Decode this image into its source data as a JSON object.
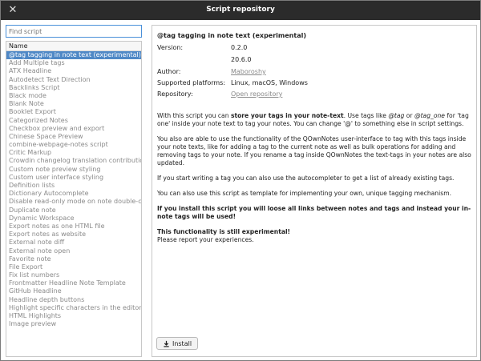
{
  "window": {
    "title": "Script repository"
  },
  "search": {
    "placeholder": "Find script",
    "value": ""
  },
  "list": {
    "header": "Name",
    "items": [
      "@tag tagging in note text (experimental)",
      "Add Multiple tags",
      "ATX Headline",
      "Autodetect Text Direction",
      "Backlinks Script",
      "Black mode",
      "Blank Note",
      "Booklet Export",
      "Categorized Notes",
      "Checkbox preview and export",
      "Chinese Space Preview",
      "combine-webpage-notes script",
      "Critic Markup",
      "Crowdin changelog translation contribution",
      "Custom note preview styling",
      "Custom user interface styling",
      "Definition lists",
      "Dictionary Autocomplete",
      "Disable read-only mode on note double-click",
      "Duplicate note",
      "Dynamic Workspace",
      "Export notes as one HTML file",
      "Export notes as website",
      "External note diff",
      "External note open",
      "Favorite note",
      "File Export",
      "Fix list numbers",
      "Frontmatter Headline Note Template",
      "GitHub Headline",
      "Headline depth buttons",
      "Highlight specific characters in the editor",
      "HTML Highlights",
      "Image preview"
    ]
  },
  "details": {
    "title": "@tag tagging in note text (experimental)",
    "version_label": "Version:",
    "version": "0.2.0",
    "min_version": "20.6.0",
    "author_label": "Author:",
    "author": "Maboroshy",
    "platforms_label": "Supported platforms:",
    "platforms": "Linux, macOS, Windows",
    "repository_label": "Repository:",
    "repository": "Open repository",
    "p1_a": "With this script you can ",
    "p1_b": "store your tags in your note-text",
    "p1_c": ". Use tags like ",
    "p1_d": "@tag",
    "p1_e": " or ",
    "p1_f": "@tag_one",
    "p1_g": " for 'tag one' inside your note text to tag your notes. You can change '@' to something else in script settings.",
    "p2": "You also are able to use the functionality of the QOwnNotes user-interface to tag with this tags inside your note texts, like for adding a tag to the current note as well as bulk operations for adding and removing tags to your note. If you rename a tag inside QOwnNotes the text-tags in your notes are also updated.",
    "p3": "If you start writing a tag you can also use the autocompleter to get a list of already existing tags.",
    "p4": "You can also use this script as template for implementing your own, unique tagging mechanism.",
    "p5": "If you install this script you will loose all links between notes and tags and instead your in-note tags will be used!",
    "p6": "This functionality is still experimental!",
    "p7": "Please report your experiences.",
    "install_label": "Install"
  }
}
